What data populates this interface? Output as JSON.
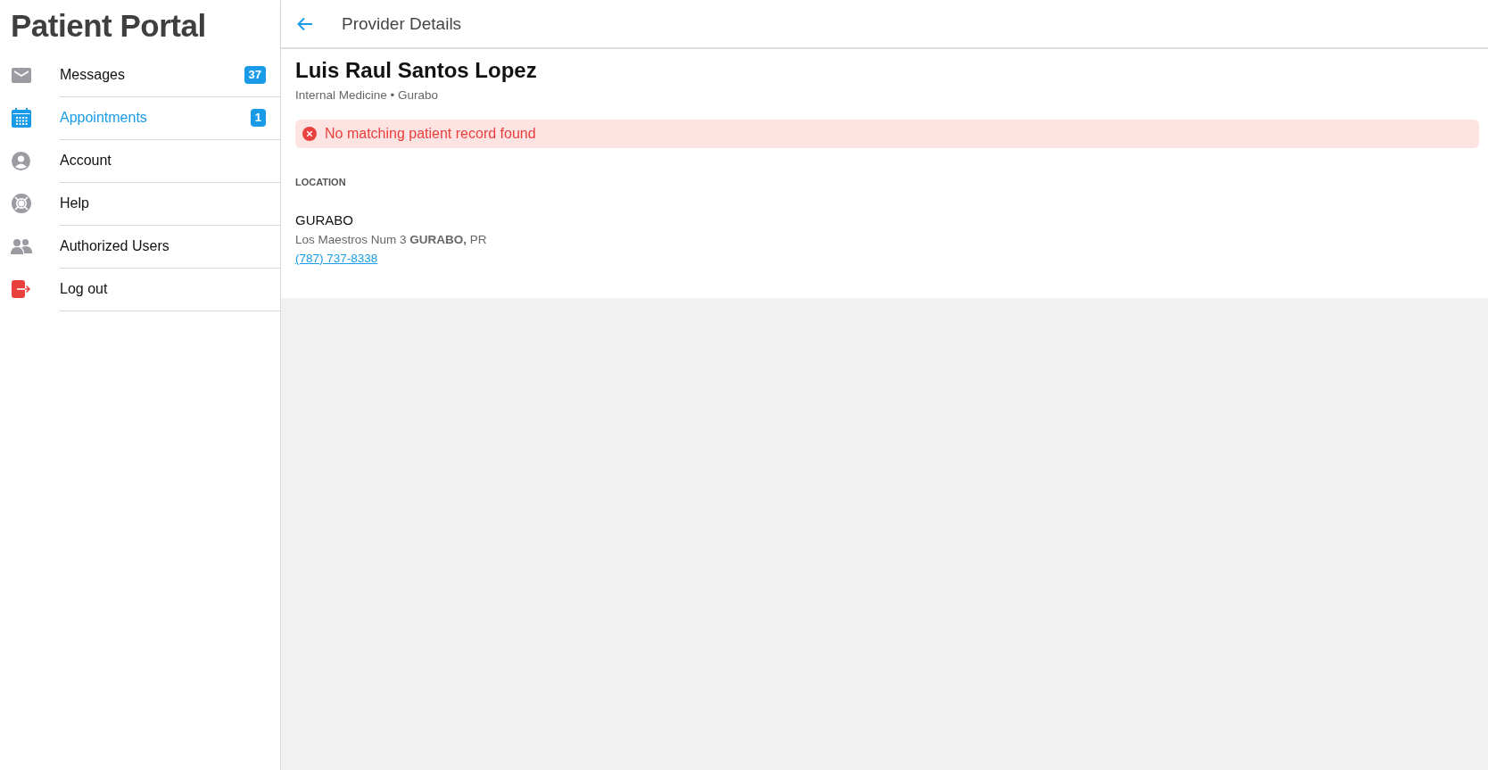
{
  "sidebar": {
    "title": "Patient Portal",
    "items": [
      {
        "kind": "mail",
        "label": "Messages",
        "badge": "37",
        "selected": false
      },
      {
        "kind": "calendar",
        "label": "Appointments",
        "badge": "1",
        "selected": true
      },
      {
        "kind": "person",
        "label": "Account",
        "selected": false
      },
      {
        "kind": "lifebuoy",
        "label": "Help",
        "selected": false
      },
      {
        "kind": "people",
        "label": "Authorized Users",
        "selected": false
      },
      {
        "kind": "logout",
        "label": "Log out",
        "selected": false
      }
    ]
  },
  "header": {
    "title": "Provider Details"
  },
  "provider": {
    "name": "Luis Raul Santos Lopez",
    "subtitle": "Internal Medicine • Gurabo"
  },
  "alert": {
    "message": "No matching patient record found"
  },
  "location": {
    "heading": "LOCATION",
    "name": "GURABO",
    "address": "Los Maestros Num 3 **GURABO,** PR",
    "phone": "(787) 737-8338"
  }
}
